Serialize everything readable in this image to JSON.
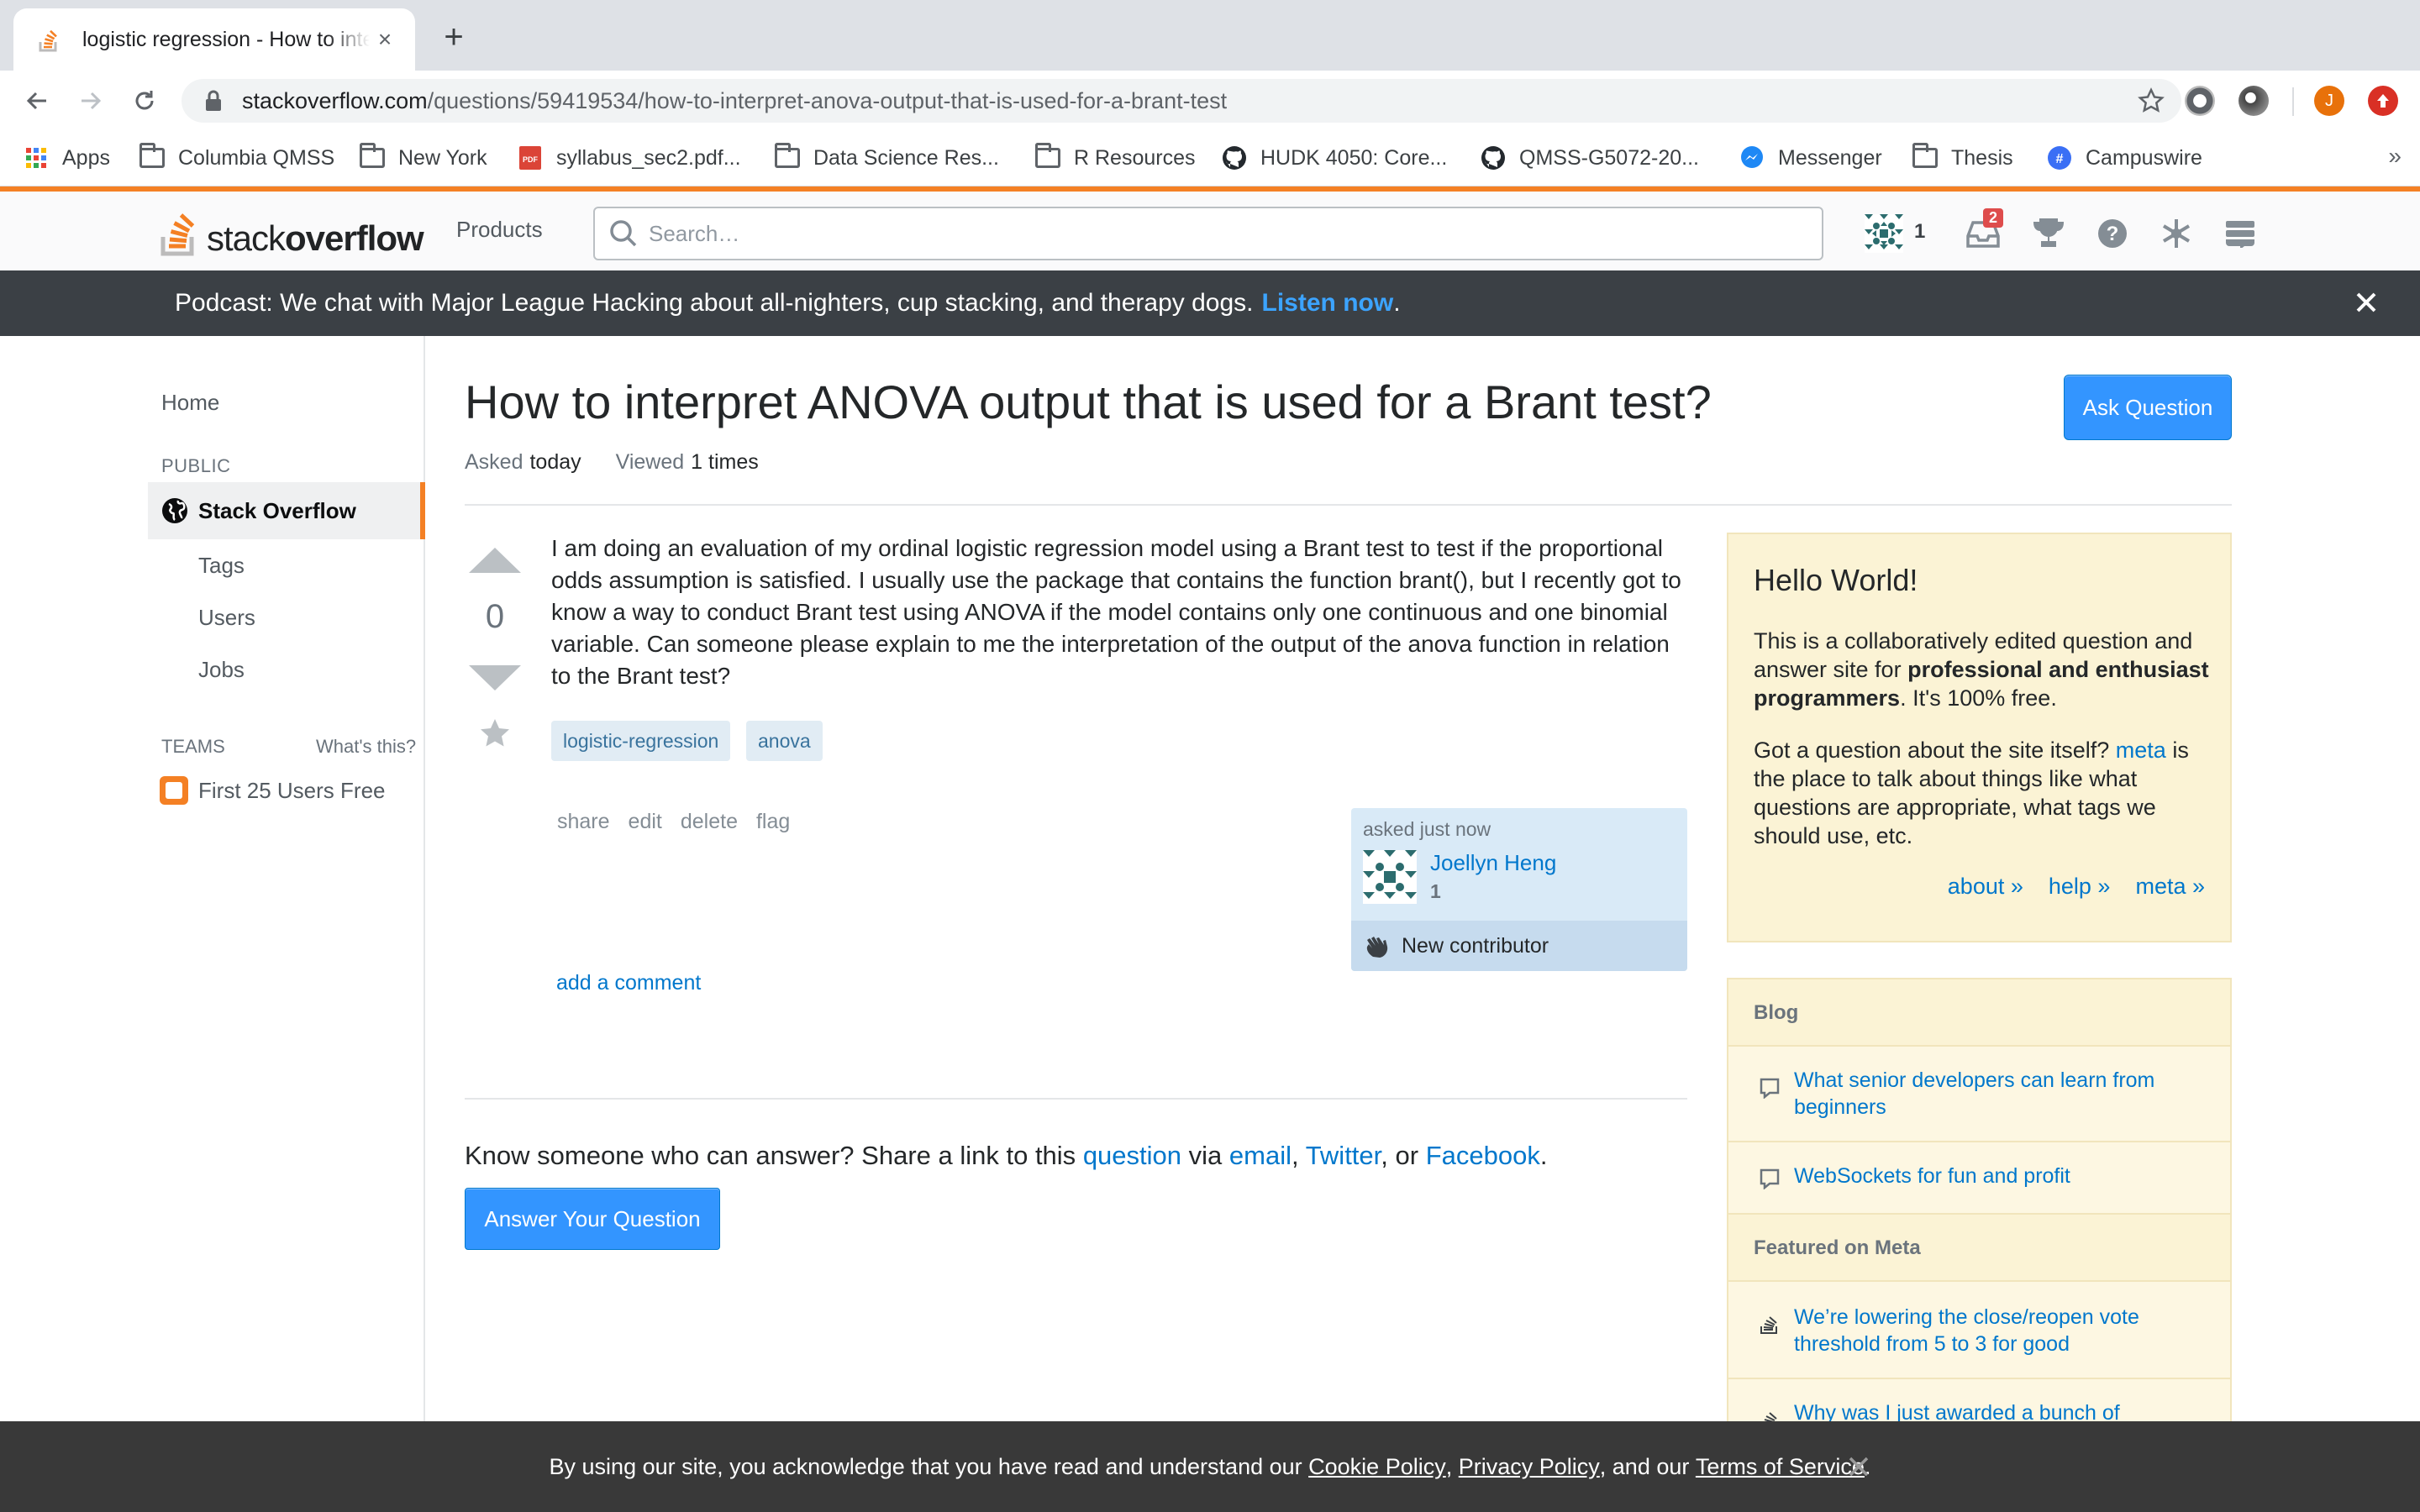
{
  "browser": {
    "tab_title": "logistic regression - How to interpret ANOVA output that is used for a Brant test? - Stack Overflow",
    "url_host": "stackoverflow.com",
    "url_path": "/questions/59419534/how-to-interpret-anova-output-that-is-used-for-a-brant-test",
    "profile_initial": "J",
    "bookmarks": [
      {
        "label": "Apps",
        "icon": "apps-grid-icon"
      },
      {
        "label": "Columbia QMSS",
        "icon": "folder-icon"
      },
      {
        "label": "New York",
        "icon": "folder-icon"
      },
      {
        "label": "syllabus_sec2.pdf...",
        "icon": "pdf-icon"
      },
      {
        "label": "Data Science Res...",
        "icon": "folder-icon"
      },
      {
        "label": "R Resources",
        "icon": "folder-icon"
      },
      {
        "label": "HUDK 4050: Core...",
        "icon": "github-icon"
      },
      {
        "label": "QMSS-G5072-20...",
        "icon": "github-icon"
      },
      {
        "label": "Messenger",
        "icon": "messenger-icon"
      },
      {
        "label": "Thesis",
        "icon": "folder-icon"
      },
      {
        "label": "Campuswire",
        "icon": "campuswire-icon"
      }
    ],
    "more": "»"
  },
  "so_header": {
    "logo_light": "stack",
    "logo_bold": "overflow",
    "products": "Products",
    "search_placeholder": "Search…",
    "reputation": "1",
    "inbox_count": "2",
    "accent_color": "#f48024"
  },
  "banner": {
    "text": "Podcast: We chat with Major League Hacking about all-nighters, cup stacking, and therapy dogs.",
    "link": "Listen now",
    "tail": "."
  },
  "leftnav": {
    "home": "Home",
    "public_label": "PUBLIC",
    "stack_overflow": "Stack Overflow",
    "tags": "Tags",
    "users": "Users",
    "jobs": "Jobs",
    "teams_label": "TEAMS",
    "whats_this": "What's this?",
    "first_25": "First 25 Users Free"
  },
  "question": {
    "title": "How to interpret ANOVA output that is used for a Brant test?",
    "ask_button": "Ask Question",
    "asked_label": "Asked",
    "asked_value": "today",
    "viewed_label": "Viewed",
    "viewed_value": "1 times",
    "votes": "0",
    "body": "I am doing an evaluation of my ordinal logistic regression model using a Brant test to test if the proportional odds assumption is satisfied. I usually use the package that contains the function brant(), but I recently got to know a way to conduct Brant test using ANOVA if the model contains only one continuous and one binomial variable. Can someone please explain to me the interpretation of the output of the anova function in relation to the Brant test?",
    "tags": [
      "logistic-regression",
      "anova"
    ],
    "menu": [
      "share",
      "edit",
      "delete",
      "flag"
    ],
    "asked_time": "asked just now",
    "user_name": "Joellyn Heng",
    "user_rep": "1",
    "new_contributor": "New contributor",
    "add_comment": "add a comment",
    "share_prefix": "Know someone who can answer? Share a link to this",
    "share_question": "question",
    "share_via": "via",
    "share_email": "email",
    "share_twitter": "Twitter",
    "share_or": ", or",
    "share_facebook": "Facebook",
    "answer_button": "Answer Your Question"
  },
  "sidebar": {
    "hello_title": "Hello World!",
    "hello_p1_a": "This is a collaboratively edited question and answer site for",
    "hello_p1_bold": "professional and enthusiast programmers",
    "hello_p1_b": ". It's 100% free.",
    "hello_p2_a": "Got a question about the site itself?",
    "hello_p2_link": "meta",
    "hello_p2_b": "is the place to talk about things like what questions are appropriate, what tags we should use, etc.",
    "links": [
      "about »",
      "help »",
      "meta »"
    ],
    "blog_header": "Blog",
    "blog_items": [
      "What senior developers can learn from beginners",
      "WebSockets for fun and profit"
    ],
    "meta_header": "Featured on Meta",
    "meta_items": [
      "We’re lowering the close/reopen vote threshold from 5 to 3 for good",
      "Why was I just awarded a bunch of"
    ]
  },
  "cookie": {
    "a": "By using our site, you acknowledge that you have read and understand our",
    "cookie_policy": "Cookie Policy",
    "privacy_policy": "Privacy Policy",
    "and_our": ", and our",
    "terms": "Terms of Service",
    "end": "."
  }
}
